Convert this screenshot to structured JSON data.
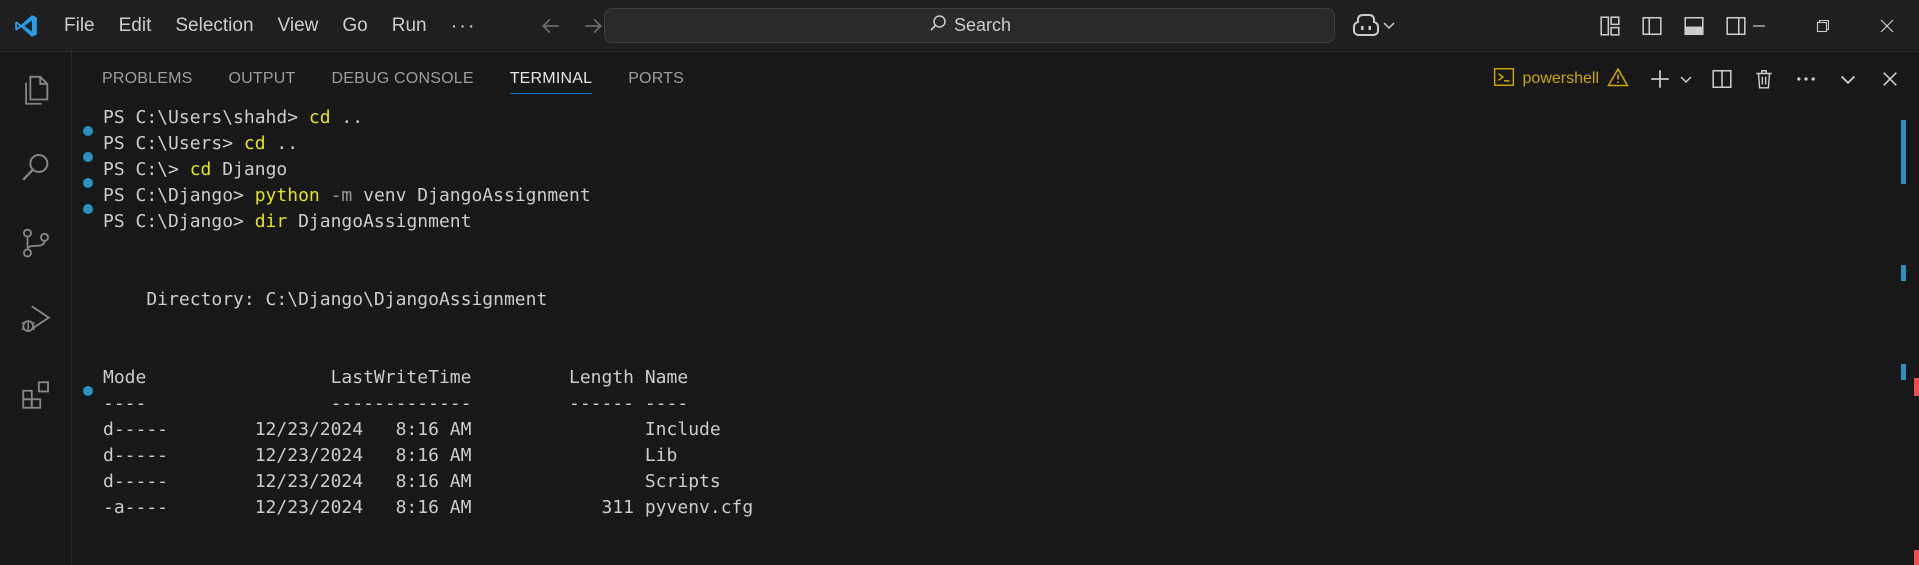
{
  "menu": [
    "File",
    "Edit",
    "Selection",
    "View",
    "Go",
    "Run",
    "···"
  ],
  "search": {
    "label": "Search"
  },
  "panel": {
    "tabs": [
      {
        "label": "PROBLEMS",
        "active": false
      },
      {
        "label": "OUTPUT",
        "active": false
      },
      {
        "label": "DEBUG CONSOLE",
        "active": false
      },
      {
        "label": "TERMINAL",
        "active": true
      },
      {
        "label": "PORTS",
        "active": false
      }
    ],
    "terminal_name": "powershell"
  },
  "terminal": {
    "prompts": [
      {
        "prompt": "PS C:\\Users\\shahd> ",
        "cmd": "cd",
        "args": " ..",
        "flag": ""
      },
      {
        "prompt": "PS C:\\Users> ",
        "cmd": "cd",
        "args": " ..",
        "flag": ""
      },
      {
        "prompt": "PS C:\\> ",
        "cmd": "cd",
        "args": " Django",
        "flag": ""
      },
      {
        "prompt": "PS C:\\Django> ",
        "cmd": "python",
        "flag": " -m",
        "args": " venv DjangoAssignment"
      },
      {
        "prompt": "PS C:\\Django> ",
        "cmd": "dir",
        "args": " DjangoAssignment",
        "flag": ""
      }
    ],
    "directory_line": "    Directory: C:\\Django\\DjangoAssignment",
    "header": "Mode                 LastWriteTime         Length Name",
    "separator": "----                 -------------         ------ ----",
    "rows": [
      "d-----        12/23/2024   8:16 AM                Include",
      "d-----        12/23/2024   8:16 AM                Lib",
      "d-----        12/23/2024   8:16 AM                Scripts",
      "-a----        12/23/2024   8:16 AM            311 pyvenv.cfg"
    ]
  },
  "colors": {
    "accent": "#0078d4",
    "command": "#e5e510",
    "warning": "#cca700",
    "decoration": "#2a8fc1"
  }
}
